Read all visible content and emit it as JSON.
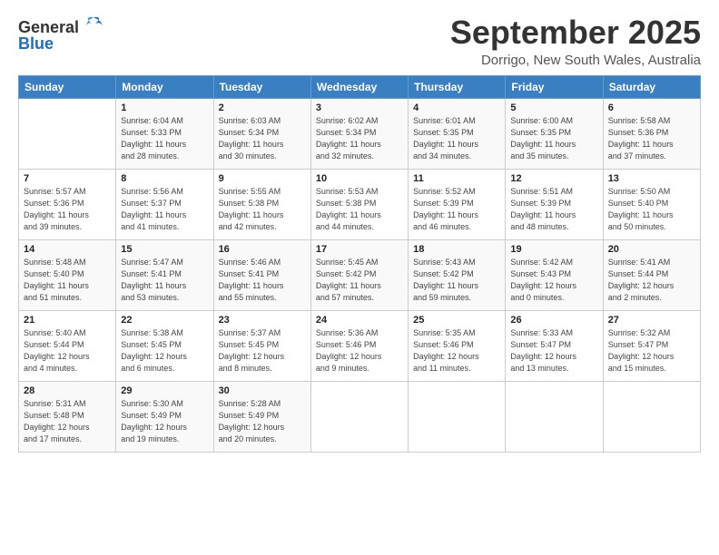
{
  "header": {
    "logo_general": "General",
    "logo_blue": "Blue",
    "title": "September 2025",
    "subtitle": "Dorrigo, New South Wales, Australia"
  },
  "days_of_week": [
    "Sunday",
    "Monday",
    "Tuesday",
    "Wednesday",
    "Thursday",
    "Friday",
    "Saturday"
  ],
  "weeks": [
    [
      {
        "day": "",
        "info": ""
      },
      {
        "day": "1",
        "info": "Sunrise: 6:04 AM\nSunset: 5:33 PM\nDaylight: 11 hours\nand 28 minutes."
      },
      {
        "day": "2",
        "info": "Sunrise: 6:03 AM\nSunset: 5:34 PM\nDaylight: 11 hours\nand 30 minutes."
      },
      {
        "day": "3",
        "info": "Sunrise: 6:02 AM\nSunset: 5:34 PM\nDaylight: 11 hours\nand 32 minutes."
      },
      {
        "day": "4",
        "info": "Sunrise: 6:01 AM\nSunset: 5:35 PM\nDaylight: 11 hours\nand 34 minutes."
      },
      {
        "day": "5",
        "info": "Sunrise: 6:00 AM\nSunset: 5:35 PM\nDaylight: 11 hours\nand 35 minutes."
      },
      {
        "day": "6",
        "info": "Sunrise: 5:58 AM\nSunset: 5:36 PM\nDaylight: 11 hours\nand 37 minutes."
      }
    ],
    [
      {
        "day": "7",
        "info": "Sunrise: 5:57 AM\nSunset: 5:36 PM\nDaylight: 11 hours\nand 39 minutes."
      },
      {
        "day": "8",
        "info": "Sunrise: 5:56 AM\nSunset: 5:37 PM\nDaylight: 11 hours\nand 41 minutes."
      },
      {
        "day": "9",
        "info": "Sunrise: 5:55 AM\nSunset: 5:38 PM\nDaylight: 11 hours\nand 42 minutes."
      },
      {
        "day": "10",
        "info": "Sunrise: 5:53 AM\nSunset: 5:38 PM\nDaylight: 11 hours\nand 44 minutes."
      },
      {
        "day": "11",
        "info": "Sunrise: 5:52 AM\nSunset: 5:39 PM\nDaylight: 11 hours\nand 46 minutes."
      },
      {
        "day": "12",
        "info": "Sunrise: 5:51 AM\nSunset: 5:39 PM\nDaylight: 11 hours\nand 48 minutes."
      },
      {
        "day": "13",
        "info": "Sunrise: 5:50 AM\nSunset: 5:40 PM\nDaylight: 11 hours\nand 50 minutes."
      }
    ],
    [
      {
        "day": "14",
        "info": "Sunrise: 5:48 AM\nSunset: 5:40 PM\nDaylight: 11 hours\nand 51 minutes."
      },
      {
        "day": "15",
        "info": "Sunrise: 5:47 AM\nSunset: 5:41 PM\nDaylight: 11 hours\nand 53 minutes."
      },
      {
        "day": "16",
        "info": "Sunrise: 5:46 AM\nSunset: 5:41 PM\nDaylight: 11 hours\nand 55 minutes."
      },
      {
        "day": "17",
        "info": "Sunrise: 5:45 AM\nSunset: 5:42 PM\nDaylight: 11 hours\nand 57 minutes."
      },
      {
        "day": "18",
        "info": "Sunrise: 5:43 AM\nSunset: 5:42 PM\nDaylight: 11 hours\nand 59 minutes."
      },
      {
        "day": "19",
        "info": "Sunrise: 5:42 AM\nSunset: 5:43 PM\nDaylight: 12 hours\nand 0 minutes."
      },
      {
        "day": "20",
        "info": "Sunrise: 5:41 AM\nSunset: 5:44 PM\nDaylight: 12 hours\nand 2 minutes."
      }
    ],
    [
      {
        "day": "21",
        "info": "Sunrise: 5:40 AM\nSunset: 5:44 PM\nDaylight: 12 hours\nand 4 minutes."
      },
      {
        "day": "22",
        "info": "Sunrise: 5:38 AM\nSunset: 5:45 PM\nDaylight: 12 hours\nand 6 minutes."
      },
      {
        "day": "23",
        "info": "Sunrise: 5:37 AM\nSunset: 5:45 PM\nDaylight: 12 hours\nand 8 minutes."
      },
      {
        "day": "24",
        "info": "Sunrise: 5:36 AM\nSunset: 5:46 PM\nDaylight: 12 hours\nand 9 minutes."
      },
      {
        "day": "25",
        "info": "Sunrise: 5:35 AM\nSunset: 5:46 PM\nDaylight: 12 hours\nand 11 minutes."
      },
      {
        "day": "26",
        "info": "Sunrise: 5:33 AM\nSunset: 5:47 PM\nDaylight: 12 hours\nand 13 minutes."
      },
      {
        "day": "27",
        "info": "Sunrise: 5:32 AM\nSunset: 5:47 PM\nDaylight: 12 hours\nand 15 minutes."
      }
    ],
    [
      {
        "day": "28",
        "info": "Sunrise: 5:31 AM\nSunset: 5:48 PM\nDaylight: 12 hours\nand 17 minutes."
      },
      {
        "day": "29",
        "info": "Sunrise: 5:30 AM\nSunset: 5:49 PM\nDaylight: 12 hours\nand 19 minutes."
      },
      {
        "day": "30",
        "info": "Sunrise: 5:28 AM\nSunset: 5:49 PM\nDaylight: 12 hours\nand 20 minutes."
      },
      {
        "day": "",
        "info": ""
      },
      {
        "day": "",
        "info": ""
      },
      {
        "day": "",
        "info": ""
      },
      {
        "day": "",
        "info": ""
      }
    ]
  ]
}
